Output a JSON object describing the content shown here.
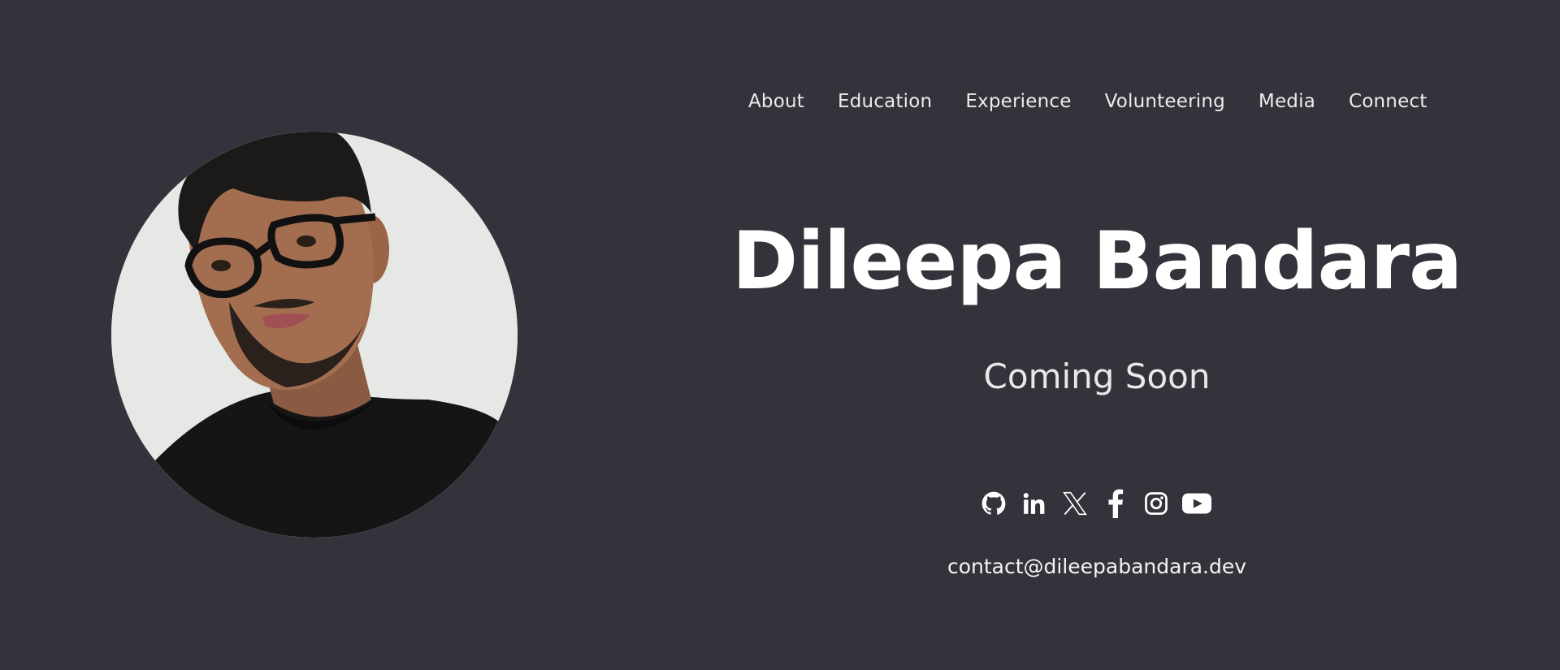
{
  "nav": {
    "items": [
      {
        "label": "About"
      },
      {
        "label": "Education"
      },
      {
        "label": "Experience"
      },
      {
        "label": "Volunteering"
      },
      {
        "label": "Media"
      },
      {
        "label": "Connect"
      }
    ]
  },
  "hero": {
    "name": "Dileepa Bandara",
    "tagline": "Coming Soon",
    "email": "contact@dileepabandara.dev"
  },
  "socials": [
    {
      "icon": "github-icon"
    },
    {
      "icon": "linkedin-icon"
    },
    {
      "icon": "x-icon"
    },
    {
      "icon": "facebook-icon"
    },
    {
      "icon": "instagram-icon"
    },
    {
      "icon": "youtube-icon"
    }
  ],
  "colors": {
    "background": "#33333b",
    "text": "#ffffff",
    "portrait_bg": "#e6e8e6"
  }
}
